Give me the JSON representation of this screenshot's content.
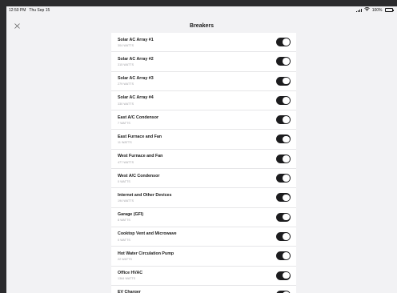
{
  "status_bar": {
    "time": "12:50 PM",
    "date": "Thu Sep 15",
    "battery": "100%"
  },
  "header": {
    "title": "Breakers"
  },
  "breakers": [
    {
      "name": "Solar AC Array #1",
      "watts": "304 WATTS",
      "on": true
    },
    {
      "name": "Solar AC Array #2",
      "watts": "315 WATTS",
      "on": true
    },
    {
      "name": "Solar AC Array #3",
      "watts": "279 WATTS",
      "on": true
    },
    {
      "name": "Solar AC Array #4",
      "watts": "330 WATTS",
      "on": true
    },
    {
      "name": "East A/C Condensor",
      "watts": "7 WATTS",
      "on": true
    },
    {
      "name": "East Furnace and Fan",
      "watts": "11 WATTS",
      "on": true
    },
    {
      "name": "West Furnace and Fan",
      "watts": "477 WATTS",
      "on": true
    },
    {
      "name": "West A/C Condensor",
      "watts": "0 WATTS",
      "on": true
    },
    {
      "name": "Internet and Other Devices",
      "watts": "194 WATTS",
      "on": true
    },
    {
      "name": "Garage (GFI)",
      "watts": "8 WATTS",
      "on": true
    },
    {
      "name": "Cooktop Vent and Microwave",
      "watts": "0 WATTS",
      "on": true
    },
    {
      "name": "Hot Water Circulation Pump",
      "watts": "22 WATTS",
      "on": true
    },
    {
      "name": "Office HVAC",
      "watts": "1364 WATTS",
      "on": true
    },
    {
      "name": "EV Charger",
      "watts": "",
      "on": true
    }
  ],
  "colors": {
    "toggle_on": "#1c1c1e",
    "background": "#f2f2f4",
    "card": "#ffffff",
    "secondary_text": "#9a9a9f"
  },
  "icons": {
    "close": "close-icon",
    "signal": "cellular-signal-icon",
    "wifi": "wifi-icon",
    "battery": "battery-icon"
  }
}
